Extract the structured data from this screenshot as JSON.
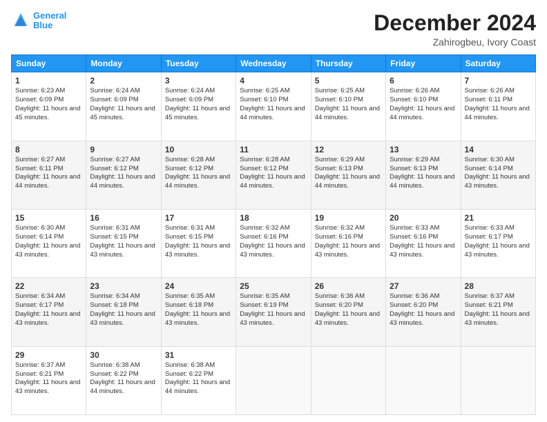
{
  "header": {
    "logo_line1": "General",
    "logo_line2": "Blue",
    "main_title": "December 2024",
    "subtitle": "Zahirogbeu, Ivory Coast"
  },
  "days_of_week": [
    "Sunday",
    "Monday",
    "Tuesday",
    "Wednesday",
    "Thursday",
    "Friday",
    "Saturday"
  ],
  "weeks": [
    [
      {
        "day": "1",
        "sunrise": "6:23 AM",
        "sunset": "6:09 PM",
        "daylight": "11 hours and 45 minutes."
      },
      {
        "day": "2",
        "sunrise": "6:24 AM",
        "sunset": "6:09 PM",
        "daylight": "11 hours and 45 minutes."
      },
      {
        "day": "3",
        "sunrise": "6:24 AM",
        "sunset": "6:09 PM",
        "daylight": "11 hours and 45 minutes."
      },
      {
        "day": "4",
        "sunrise": "6:25 AM",
        "sunset": "6:10 PM",
        "daylight": "11 hours and 44 minutes."
      },
      {
        "day": "5",
        "sunrise": "6:25 AM",
        "sunset": "6:10 PM",
        "daylight": "11 hours and 44 minutes."
      },
      {
        "day": "6",
        "sunrise": "6:26 AM",
        "sunset": "6:10 PM",
        "daylight": "11 hours and 44 minutes."
      },
      {
        "day": "7",
        "sunrise": "6:26 AM",
        "sunset": "6:11 PM",
        "daylight": "11 hours and 44 minutes."
      }
    ],
    [
      {
        "day": "8",
        "sunrise": "6:27 AM",
        "sunset": "6:11 PM",
        "daylight": "11 hours and 44 minutes."
      },
      {
        "day": "9",
        "sunrise": "6:27 AM",
        "sunset": "6:12 PM",
        "daylight": "11 hours and 44 minutes."
      },
      {
        "day": "10",
        "sunrise": "6:28 AM",
        "sunset": "6:12 PM",
        "daylight": "11 hours and 44 minutes."
      },
      {
        "day": "11",
        "sunrise": "6:28 AM",
        "sunset": "6:12 PM",
        "daylight": "11 hours and 44 minutes."
      },
      {
        "day": "12",
        "sunrise": "6:29 AM",
        "sunset": "6:13 PM",
        "daylight": "11 hours and 44 minutes."
      },
      {
        "day": "13",
        "sunrise": "6:29 AM",
        "sunset": "6:13 PM",
        "daylight": "11 hours and 44 minutes."
      },
      {
        "day": "14",
        "sunrise": "6:30 AM",
        "sunset": "6:14 PM",
        "daylight": "11 hours and 43 minutes."
      }
    ],
    [
      {
        "day": "15",
        "sunrise": "6:30 AM",
        "sunset": "6:14 PM",
        "daylight": "11 hours and 43 minutes."
      },
      {
        "day": "16",
        "sunrise": "6:31 AM",
        "sunset": "6:15 PM",
        "daylight": "11 hours and 43 minutes."
      },
      {
        "day": "17",
        "sunrise": "6:31 AM",
        "sunset": "6:15 PM",
        "daylight": "11 hours and 43 minutes."
      },
      {
        "day": "18",
        "sunrise": "6:32 AM",
        "sunset": "6:16 PM",
        "daylight": "11 hours and 43 minutes."
      },
      {
        "day": "19",
        "sunrise": "6:32 AM",
        "sunset": "6:16 PM",
        "daylight": "11 hours and 43 minutes."
      },
      {
        "day": "20",
        "sunrise": "6:33 AM",
        "sunset": "6:16 PM",
        "daylight": "11 hours and 43 minutes."
      },
      {
        "day": "21",
        "sunrise": "6:33 AM",
        "sunset": "6:17 PM",
        "daylight": "11 hours and 43 minutes."
      }
    ],
    [
      {
        "day": "22",
        "sunrise": "6:34 AM",
        "sunset": "6:17 PM",
        "daylight": "11 hours and 43 minutes."
      },
      {
        "day": "23",
        "sunrise": "6:34 AM",
        "sunset": "6:18 PM",
        "daylight": "11 hours and 43 minutes."
      },
      {
        "day": "24",
        "sunrise": "6:35 AM",
        "sunset": "6:18 PM",
        "daylight": "11 hours and 43 minutes."
      },
      {
        "day": "25",
        "sunrise": "6:35 AM",
        "sunset": "6:19 PM",
        "daylight": "11 hours and 43 minutes."
      },
      {
        "day": "26",
        "sunrise": "6:36 AM",
        "sunset": "6:20 PM",
        "daylight": "11 hours and 43 minutes."
      },
      {
        "day": "27",
        "sunrise": "6:36 AM",
        "sunset": "6:20 PM",
        "daylight": "11 hours and 43 minutes."
      },
      {
        "day": "28",
        "sunrise": "6:37 AM",
        "sunset": "6:21 PM",
        "daylight": "11 hours and 43 minutes."
      }
    ],
    [
      {
        "day": "29",
        "sunrise": "6:37 AM",
        "sunset": "6:21 PM",
        "daylight": "11 hours and 43 minutes."
      },
      {
        "day": "30",
        "sunrise": "6:38 AM",
        "sunset": "6:22 PM",
        "daylight": "11 hours and 44 minutes."
      },
      {
        "day": "31",
        "sunrise": "6:38 AM",
        "sunset": "6:22 PM",
        "daylight": "11 hours and 44 minutes."
      },
      null,
      null,
      null,
      null
    ]
  ]
}
